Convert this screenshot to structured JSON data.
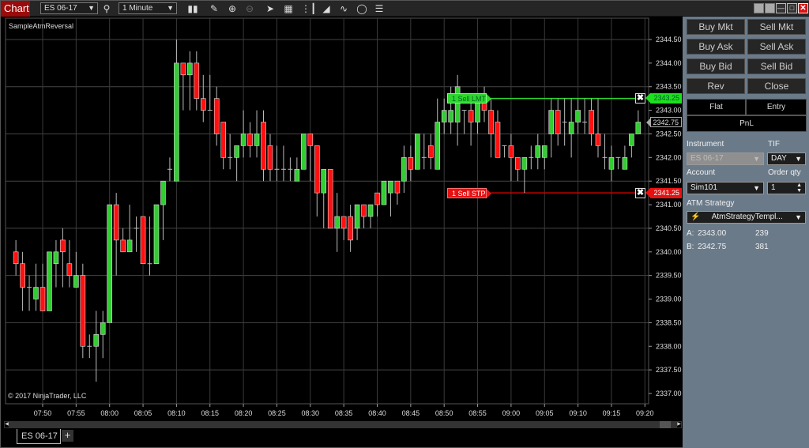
{
  "toolbar": {
    "chart_tab": "Chart",
    "instrument": "ES 06-17",
    "interval": "1 Minute",
    "icons": [
      "search-icon",
      "bars-type-icon",
      "pencil-icon",
      "zoom-in-icon",
      "zoom-out-icon",
      "pointer-icon",
      "data-box-icon",
      "bar-spacing-icon",
      "chart-trader-icon",
      "strategies-icon",
      "refresh-icon",
      "properties-icon"
    ],
    "window_buttons": [
      "pin-icon",
      "link-icon",
      "minimize-icon",
      "maximize-icon",
      "close-icon"
    ]
  },
  "chart": {
    "indicator_label": "SampleAtmReversal",
    "copyright": "© 2017 NinjaTrader, LLC",
    "instrument_tab": "ES 06-17",
    "add_tab": "+"
  },
  "orders": {
    "limit": {
      "label": "1  Sell LMT",
      "price": "2343.25",
      "color": "#2ed62e"
    },
    "stop": {
      "label": "1  Sell STP",
      "price": "2341.25",
      "color": "#e81010"
    },
    "last_price": "2342.75"
  },
  "side_panel": {
    "buttons": [
      {
        "id": "buy-mkt",
        "label": "Buy Mkt"
      },
      {
        "id": "sell-mkt",
        "label": "Sell Mkt"
      },
      {
        "id": "buy-ask",
        "label": "Buy Ask"
      },
      {
        "id": "sell-ask",
        "label": "Sell Ask"
      },
      {
        "id": "buy-bid",
        "label": "Buy Bid"
      },
      {
        "id": "sell-bid",
        "label": "Sell Bid"
      },
      {
        "id": "rev",
        "label": "Rev"
      },
      {
        "id": "close",
        "label": "Close"
      }
    ],
    "flat": "Flat",
    "entry": "Entry",
    "pnl": "PnL",
    "instrument_label": "Instrument",
    "instrument_value": "ES 06-17",
    "tif_label": "TIF",
    "tif_value": "DAY",
    "account_label": "Account",
    "account_value": "Sim101",
    "qty_label": "Order qty",
    "qty_value": "1",
    "atm_label": "ATM Strategy",
    "atm_value": "AtmStrategyTempl...",
    "ask_label": "A:",
    "ask_price": "2343.00",
    "ask_size": "239",
    "bid_label": "B:",
    "bid_price": "2342.75",
    "bid_size": "381"
  },
  "chart_data": {
    "type": "candlestick",
    "title": "SampleAtmReversal",
    "ylim": [
      2337.0,
      2344.5
    ],
    "y_ticks": [
      "2344.50",
      "2344.00",
      "2343.50",
      "2343.00",
      "2342.50",
      "2342.00",
      "2341.50",
      "2341.00",
      "2340.50",
      "2340.00",
      "2339.50",
      "2339.00",
      "2338.50",
      "2338.00",
      "2337.50",
      "2337.00"
    ],
    "x_ticks": [
      "07:50",
      "07:55",
      "08:00",
      "08:05",
      "08:10",
      "08:15",
      "08:20",
      "08:25",
      "08:30",
      "08:35",
      "08:40",
      "08:45",
      "08:50",
      "08:55",
      "09:00",
      "09:05",
      "09:10",
      "09:15",
      "09:20"
    ],
    "first_bar_time": "07:46",
    "bar_interval_minutes": 1,
    "bars": [
      [
        2340.0,
        2340.25,
        2339.5,
        2339.75
      ],
      [
        2339.75,
        2340.0,
        2338.75,
        2339.25
      ],
      [
        2339.25,
        2339.5,
        2338.75,
        2339.25
      ],
      [
        2339.0,
        2339.75,
        2338.75,
        2339.25
      ],
      [
        2339.25,
        2339.75,
        2338.75,
        2338.75
      ],
      [
        2338.75,
        2340.0,
        2338.75,
        2340.0
      ],
      [
        2339.75,
        2340.25,
        2339.25,
        2340.0
      ],
      [
        2340.25,
        2340.5,
        2339.25,
        2340.0
      ],
      [
        2339.75,
        2340.25,
        2339.25,
        2339.5
      ],
      [
        2339.25,
        2340.0,
        2339.25,
        2339.5
      ],
      [
        2339.5,
        2339.75,
        2337.75,
        2338.0
      ],
      [
        2338.0,
        2338.25,
        2337.75,
        2338.0
      ],
      [
        2338.0,
        2338.75,
        2337.25,
        2338.25
      ],
      [
        2338.25,
        2338.75,
        2337.75,
        2338.5
      ],
      [
        2338.5,
        2341.0,
        2338.5,
        2341.0
      ],
      [
        2341.0,
        2341.25,
        2339.5,
        2340.25
      ],
      [
        2340.25,
        2340.5,
        2340.0,
        2340.0
      ],
      [
        2340.0,
        2341.0,
        2340.0,
        2340.25
      ],
      [
        2340.5,
        2340.75,
        2340.0,
        2340.5
      ],
      [
        2340.75,
        2340.75,
        2339.75,
        2339.75
      ],
      [
        2339.75,
        2340.75,
        2339.5,
        2339.75
      ],
      [
        2339.75,
        2341.0,
        2339.75,
        2341.0
      ],
      [
        2341.0,
        2341.5,
        2340.25,
        2341.5
      ],
      [
        2341.75,
        2342.0,
        2341.5,
        2341.75
      ],
      [
        2341.5,
        2344.5,
        2341.5,
        2344.0
      ],
      [
        2344.0,
        2344.0,
        2343.0,
        2343.75
      ],
      [
        2343.75,
        2344.25,
        2343.0,
        2344.0
      ],
      [
        2344.0,
        2344.25,
        2343.0,
        2343.25
      ],
      [
        2343.25,
        2343.75,
        2342.75,
        2343.0
      ],
      [
        2343.0,
        2343.75,
        2343.0,
        2343.0
      ],
      [
        2343.25,
        2343.5,
        2342.25,
        2342.5
      ],
      [
        2342.75,
        2342.75,
        2341.75,
        2342.0
      ],
      [
        2342.0,
        2342.5,
        2341.75,
        2342.0
      ],
      [
        2342.0,
        2342.25,
        2341.5,
        2342.25
      ],
      [
        2342.25,
        2343.0,
        2342.0,
        2342.5
      ],
      [
        2342.5,
        2342.75,
        2342.0,
        2342.25
      ],
      [
        2342.25,
        2343.0,
        2342.0,
        2342.5
      ],
      [
        2342.75,
        2343.0,
        2341.5,
        2341.75
      ],
      [
        2342.25,
        2342.5,
        2341.5,
        2341.75
      ],
      [
        2341.75,
        2342.25,
        2341.5,
        2341.75
      ],
      [
        2341.75,
        2342.25,
        2341.5,
        2341.75
      ],
      [
        2341.75,
        2342.0,
        2341.5,
        2341.75
      ],
      [
        2341.5,
        2342.0,
        2341.5,
        2341.75
      ],
      [
        2341.75,
        2342.5,
        2341.75,
        2342.5
      ],
      [
        2342.5,
        2342.5,
        2341.5,
        2342.25
      ],
      [
        2342.25,
        2342.25,
        2340.75,
        2341.25
      ],
      [
        2341.25,
        2341.75,
        2340.5,
        2341.75
      ],
      [
        2341.75,
        2341.75,
        2340.5,
        2340.5
      ],
      [
        2340.5,
        2341.25,
        2340.0,
        2340.75
      ],
      [
        2340.75,
        2340.75,
        2340.25,
        2340.5
      ],
      [
        2340.75,
        2341.0,
        2340.0,
        2340.25
      ],
      [
        2340.5,
        2341.0,
        2340.25,
        2341.0
      ],
      [
        2341.0,
        2341.0,
        2340.5,
        2340.75
      ],
      [
        2340.75,
        2341.0,
        2340.5,
        2341.0
      ],
      [
        2341.25,
        2341.25,
        2340.75,
        2341.0
      ],
      [
        2341.0,
        2341.5,
        2341.0,
        2341.5
      ],
      [
        2341.25,
        2341.5,
        2340.75,
        2341.5
      ],
      [
        2341.5,
        2341.5,
        2341.0,
        2341.25
      ],
      [
        2341.5,
        2342.25,
        2341.25,
        2342.0
      ],
      [
        2342.0,
        2342.25,
        2341.5,
        2341.75
      ],
      [
        2341.75,
        2342.5,
        2341.75,
        2342.5
      ],
      [
        2342.0,
        2342.5,
        2341.75,
        2342.0
      ],
      [
        2342.25,
        2342.5,
        2341.75,
        2342.0
      ],
      [
        2341.75,
        2343.25,
        2341.75,
        2342.75
      ],
      [
        2342.75,
        2343.25,
        2342.5,
        2343.0
      ],
      [
        2342.75,
        2343.5,
        2342.5,
        2343.0
      ],
      [
        2342.75,
        2343.75,
        2342.25,
        2343.5
      ],
      [
        2343.0,
        2343.0,
        2342.5,
        2343.0
      ],
      [
        2343.0,
        2343.25,
        2342.25,
        2342.75
      ],
      [
        2342.75,
        2343.25,
        2342.5,
        2343.25
      ],
      [
        2343.25,
        2343.5,
        2342.75,
        2343.0
      ],
      [
        2343.0,
        2343.25,
        2342.0,
        2342.5
      ],
      [
        2342.75,
        2343.0,
        2342.0,
        2342.0
      ],
      [
        2342.25,
        2342.25,
        2342.0,
        2342.25
      ],
      [
        2342.25,
        2342.5,
        2341.5,
        2342.0
      ],
      [
        2342.0,
        2342.0,
        2341.5,
        2341.75
      ],
      [
        2341.75,
        2342.0,
        2341.25,
        2342.0
      ],
      [
        2342.0,
        2342.25,
        2341.75,
        2342.0
      ],
      [
        2342.0,
        2342.5,
        2341.75,
        2342.25
      ],
      [
        2342.0,
        2342.25,
        2341.75,
        2342.25
      ],
      [
        2342.5,
        2343.25,
        2342.0,
        2343.0
      ],
      [
        2343.0,
        2343.25,
        2342.25,
        2342.5
      ],
      [
        2342.75,
        2343.25,
        2342.25,
        2342.75
      ],
      [
        2342.5,
        2343.25,
        2342.0,
        2342.75
      ],
      [
        2342.75,
        2343.25,
        2342.5,
        2343.0
      ],
      [
        2342.75,
        2343.25,
        2342.5,
        2342.75
      ],
      [
        2343.0,
        2343.25,
        2342.25,
        2342.5
      ],
      [
        2342.5,
        2343.25,
        2342.0,
        2342.25
      ],
      [
        2342.0,
        2342.5,
        2341.75,
        2342.0
      ],
      [
        2341.75,
        2342.25,
        2341.5,
        2342.0
      ],
      [
        2342.0,
        2342.0,
        2341.75,
        2342.0
      ],
      [
        2341.75,
        2342.25,
        2341.75,
        2342.0
      ],
      [
        2342.25,
        2342.5,
        2342.0,
        2342.5
      ],
      [
        2342.5,
        2343.0,
        2342.5,
        2342.75
      ]
    ],
    "bar_format": "open,high,low,close",
    "up_color": "#33cc33",
    "down_color": "#ff1010"
  }
}
